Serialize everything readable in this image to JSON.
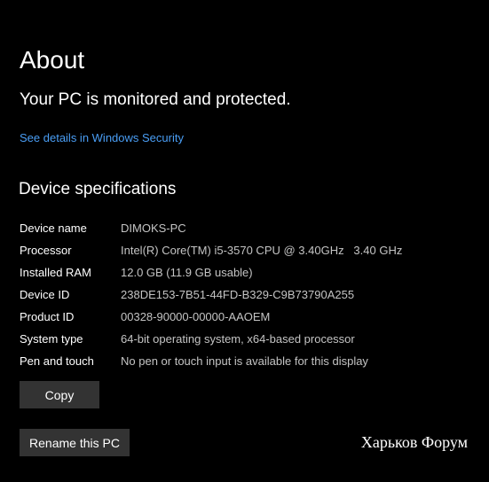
{
  "page": {
    "title": "About",
    "protection_status": "Your PC is monitored and protected.",
    "security_link": "See details in Windows Security"
  },
  "device_specs": {
    "heading": "Device specifications",
    "rows": [
      {
        "label": "Device name",
        "value": "DIMOKS-PC"
      },
      {
        "label": "Processor",
        "value": "Intel(R) Core(TM) i5-3570 CPU @ 3.40GHz   3.40 GHz"
      },
      {
        "label": "Installed RAM",
        "value": "12.0 GB (11.9 GB usable)"
      },
      {
        "label": "Device ID",
        "value": "238DE153-7B51-44FD-B329-C9B73790A255"
      },
      {
        "label": "Product ID",
        "value": "00328-90000-00000-AAOEM"
      },
      {
        "label": "System type",
        "value": "64-bit operating system, x64-based processor"
      },
      {
        "label": "Pen and touch",
        "value": "No pen or touch input is available for this display"
      }
    ],
    "copy_label": "Copy"
  },
  "actions": {
    "rename_label": "Rename this PC"
  },
  "watermark": "Харьков Форум",
  "colors": {
    "background": "#000000",
    "link": "#4a9ef5",
    "button": "#333333",
    "value_text": "#c4c4c4"
  }
}
